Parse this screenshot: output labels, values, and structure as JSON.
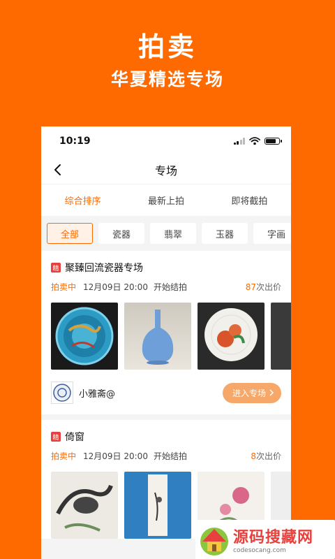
{
  "promo": {
    "title": "拍卖",
    "subtitle": "华夏精选专场"
  },
  "status_bar": {
    "time": "10:19"
  },
  "nav": {
    "title": "专场"
  },
  "sort_tabs": [
    {
      "label": "综合排序",
      "active": true
    },
    {
      "label": "最新上拍",
      "active": false
    },
    {
      "label": "即将截拍",
      "active": false
    }
  ],
  "filters": [
    {
      "label": "全部",
      "active": true
    },
    {
      "label": "瓷器",
      "active": false
    },
    {
      "label": "翡翠",
      "active": false
    },
    {
      "label": "玉器",
      "active": false
    },
    {
      "label": "字画",
      "active": false
    }
  ],
  "cards": [
    {
      "badge": "精",
      "title": "聚臻回流瓷器专场",
      "status": "拍卖中",
      "date": "12月09日 20:00",
      "action": "开始结拍",
      "bid_count": "87",
      "bid_suffix": "次出价",
      "shop_name": "小雅斋@",
      "enter_label": "进入专场"
    },
    {
      "badge": "精",
      "title": "倚窗",
      "status": "拍卖中",
      "date": "12月09日 20:00",
      "action": "开始结拍",
      "bid_count": "8",
      "bid_suffix": "次出价"
    }
  ],
  "watermark": {
    "text": "源码搜藏网",
    "url": "codesocang.com"
  },
  "colors": {
    "brand": "#FF6A00",
    "badge": "#E8403C",
    "button": "#F5A86A"
  }
}
